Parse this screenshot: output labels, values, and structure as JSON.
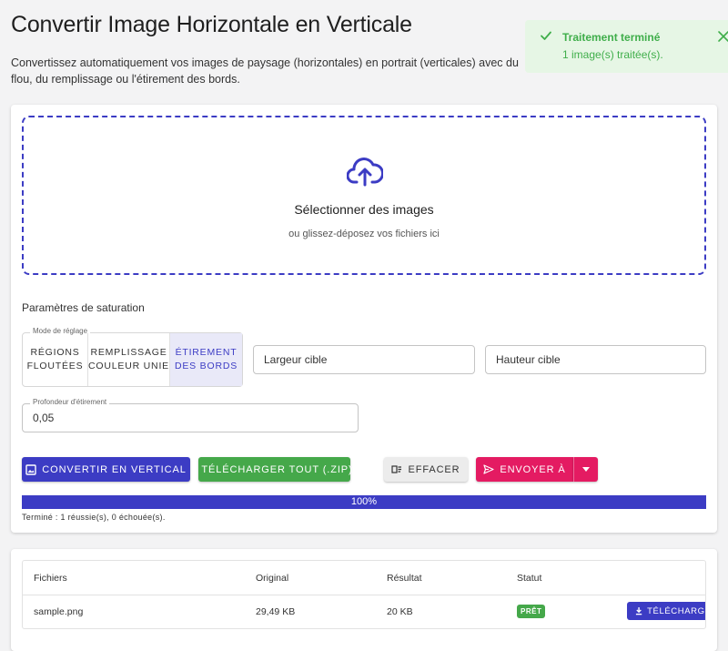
{
  "header": {
    "title": "Convertir Image Horizontale en Verticale",
    "description": "Convertissez automatiquement vos images de paysage (horizontales) en portrait (verticales) avec du flou, du remplissage ou l'étirement des bords."
  },
  "toast": {
    "title": "Traitement terminé",
    "message": "1 image(s) traitée(s)."
  },
  "dropzone": {
    "title": "Sélectionner des images",
    "subtitle": "ou glissez-déposez vos fichiers ici"
  },
  "settings": {
    "title": "Paramètres de saturation",
    "mode_legend": "Mode de réglage",
    "modes": [
      {
        "label": "RÉGIONS FLOUTÉES",
        "selected": false
      },
      {
        "label": "REMPLISSAGE COULEUR UNIE",
        "selected": false
      },
      {
        "label": "ÉTIREMENT DES BORDS",
        "selected": true
      }
    ],
    "width_placeholder": "Largeur cible",
    "height_placeholder": "Hauteur cible",
    "depth_legend": "Profondeur d'étirement",
    "depth_value": "0,05"
  },
  "actions": {
    "convert": "CONVERTIR EN VERTICAL",
    "download_zip": "TÉLÉCHARGER TOUT (.ZIP)",
    "clear": "EFFACER",
    "send": "ENVOYER À"
  },
  "progress": {
    "percent": 100,
    "label": "100%",
    "status": "Terminé : 1 réussie(s), 0 échouée(s)."
  },
  "table": {
    "headers": [
      "Fichiers",
      "Original",
      "Résultat",
      "Statut"
    ],
    "rows": [
      {
        "file": "sample.png",
        "original": "29,49 KB",
        "result": "20 KB",
        "status": "PRÊT",
        "action": "TÉLÉCHARGER"
      }
    ]
  },
  "colors": {
    "primary": "#3c3cc4",
    "success": "#45a84a",
    "accent": "#e41b62",
    "toast_bg": "#e6f6e5"
  }
}
